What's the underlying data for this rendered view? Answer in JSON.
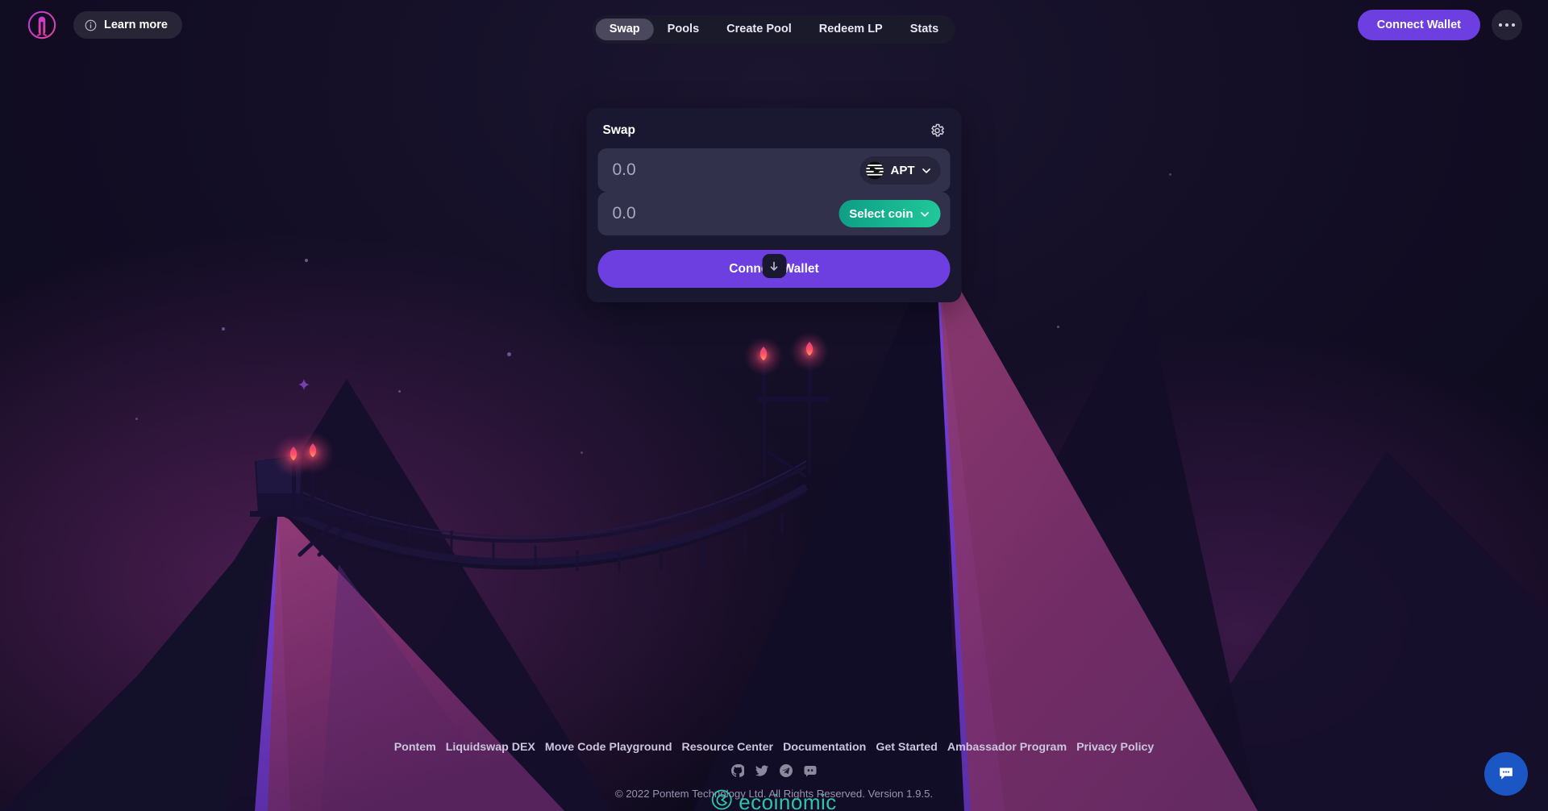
{
  "header": {
    "logo_icon": "pontem-logo-icon",
    "learn_more": {
      "label": "Learn more",
      "icon": "info-icon"
    },
    "nav": [
      {
        "label": "Swap",
        "active": true
      },
      {
        "label": "Pools",
        "active": false
      },
      {
        "label": "Create Pool",
        "active": false
      },
      {
        "label": "Redeem LP",
        "active": false
      },
      {
        "label": "Stats",
        "active": false
      }
    ],
    "connect_wallet_label": "Connect Wallet",
    "more_menu_icon": "ellipsis-icon"
  },
  "swap": {
    "title": "Swap",
    "settings_icon": "gear-icon",
    "from": {
      "value": "",
      "placeholder": "0.0",
      "coin_label": "APT",
      "coin_icon": "aptos-coin-icon",
      "chevron_icon": "chevron-down-icon"
    },
    "switch_icon": "arrow-down-icon",
    "to": {
      "value": "",
      "placeholder": "0.0",
      "coin_label": "Select coin",
      "chevron_icon": "chevron-down-icon"
    },
    "submit_label": "Connect Wallet"
  },
  "footer": {
    "links": [
      "Pontem",
      "Liquidswap DEX",
      "Move Code Playground",
      "Resource Center",
      "Documentation",
      "Get Started",
      "Ambassador Program",
      "Privacy Policy"
    ],
    "socials": [
      {
        "name": "github-icon"
      },
      {
        "name": "twitter-icon"
      },
      {
        "name": "telegram-icon"
      },
      {
        "name": "discord-icon"
      }
    ],
    "copyright": "© 2022 Pontem Technology Ltd. All Rights Reserved. Version 1.9.5."
  },
  "watermark": {
    "text": "ecoinomic",
    "icon": "ecoinomic-logo-icon"
  },
  "chat": {
    "icon": "chat-bubble-icon"
  },
  "colors": {
    "accent_purple": "#6d3ee0",
    "teal": "#21c99a",
    "card_bg": "#191830",
    "field_bg": "#32314b",
    "page_bg": "#120d24",
    "chat_blue": "#1a56c4",
    "watermark_teal": "#2fc3ad"
  }
}
